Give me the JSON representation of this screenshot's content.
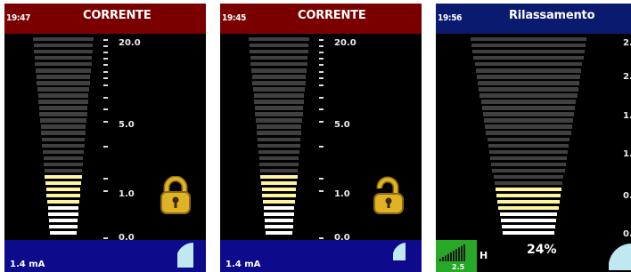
{
  "colors": {
    "header_current": "#7a0000",
    "header_relax": "#0a1a6e",
    "footer_blue": "#0d0a8c",
    "bar_off": "#404040",
    "bar_on": "#fff59a",
    "bar_on_bright": "#ffffff",
    "lock_gold": "#e0b226",
    "indicator": "#bfe8f0",
    "signal_green": "#27a827"
  },
  "panels": [
    {
      "time": "19:47",
      "title": "CORRENTE",
      "footer_value": "1.4 mA",
      "scale_labels": [
        "20.0",
        "5.0",
        "1.0",
        "0.0"
      ],
      "lock_state": "locked",
      "lock_icon": "padlock-closed-icon",
      "indicator_icon": "battery-quarter-icon",
      "level": 0.31
    },
    {
      "time": "19:45",
      "title": "CORRENTE",
      "footer_value": "1.4 mA",
      "scale_labels": [
        "20.0",
        "5.0",
        "1.0",
        "0.0"
      ],
      "lock_state": "unlocked",
      "lock_icon": "padlock-open-icon",
      "indicator_icon": "battery-quarter-icon",
      "level": 0.31
    },
    {
      "time": "19:56",
      "title": "Rilassamento",
      "percent": "24%",
      "scale_labels": [
        "2.",
        "2.",
        "1.",
        "1.",
        "0.",
        "0."
      ],
      "signal_label": "2.5 μV",
      "hz_label": "H",
      "indicator_icon": "battery-quarter-icon",
      "level": 0.24
    }
  ]
}
